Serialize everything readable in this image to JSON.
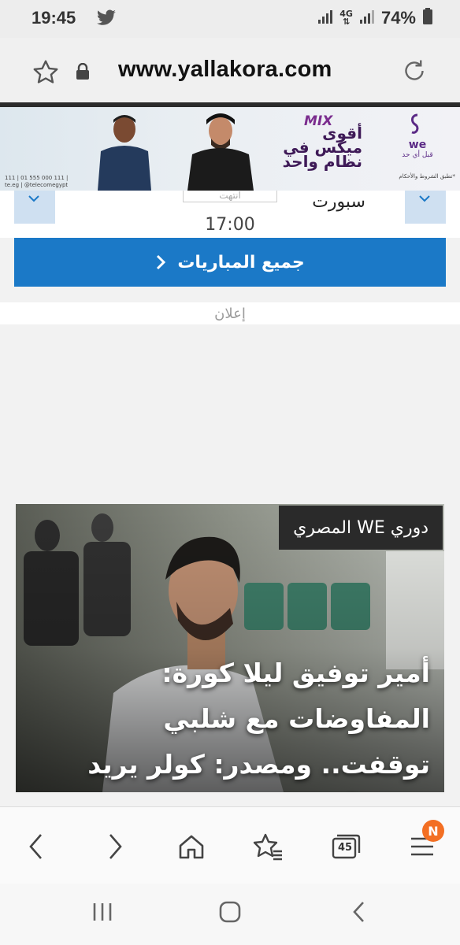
{
  "status": {
    "time": "19:45",
    "network": "4G",
    "battery": "74%"
  },
  "browser": {
    "url": "www.yallakora.com",
    "tab_count": "45",
    "menu_badge": "N"
  },
  "banner": {
    "brand": "we",
    "brand_sub": "قبل أي حد",
    "mix": "MIX",
    "headline": "أقوى ميكس في نظام واحد",
    "left_small": "111 | 01 555 000 111 | te.eg | @telecomegypt",
    "right_small": "*تطبق الشروط والأحكام"
  },
  "matches": {
    "status_label": "انتهت",
    "team": "سبورت",
    "time": "17:00",
    "all_matches_label": "جميع المباريات"
  },
  "ad": {
    "label": "إعلان"
  },
  "news": {
    "tag": "دوري WE المصري",
    "title": "أمير توفيق ليلا كورة: المفاوضات مع شلبي توقفت.. ومصدر: كولر يريد لاعب أجنبي"
  }
}
